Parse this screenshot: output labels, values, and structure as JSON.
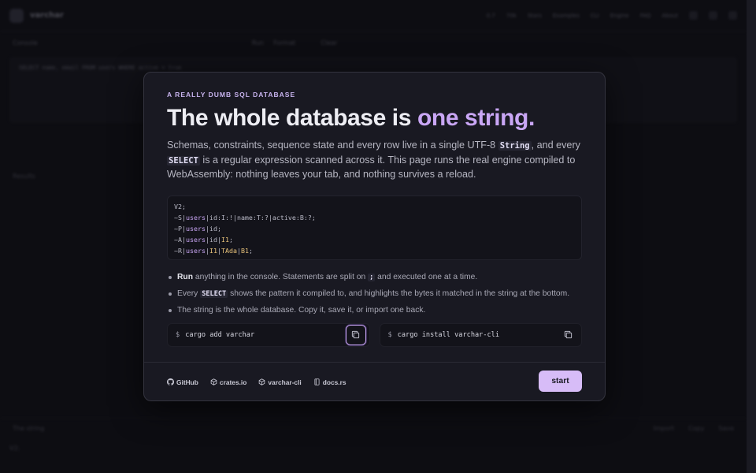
{
  "background": {
    "brand": "varchar",
    "nav": [
      "0.7",
      "70k",
      "Stars",
      "Examples",
      "CLI",
      "Engine",
      "FAQ",
      "About"
    ],
    "console_label": "Console",
    "console_tabs": [
      "Run",
      "Format",
      "Clear"
    ],
    "console_line": "SELECT name, email FROM users WHERE active = true",
    "results_label": "Results",
    "footer_label": "The string",
    "footer_actions": [
      "Import",
      "Copy",
      "Save"
    ],
    "bottom_text": "V2;"
  },
  "modal": {
    "eyebrow": "A REALLY DUMB SQL DATABASE",
    "headline_pre": "The whole database is ",
    "headline_accent": "one string.",
    "lede": {
      "p1": "Schemas, constraints, sequence state and every row live in a single UTF-8 ",
      "code1": "String",
      "p2": ", and every ",
      "code2": "SELECT",
      "p3": " is a regular expression scanned across it. This page runs the real engine compiled to WebAssembly: nothing leaves your tab, and nothing survives a reload."
    },
    "code_lines": [
      "V2;",
      "~S|users|id:I:!|name:T:?|active:B:?;",
      "~P|users|id;",
      "~A|users|id|I1;",
      "~R|users|I1|TAda|B1;"
    ],
    "bullets": {
      "b1_strong": "Run",
      "b1_rest_a": " anything in the console. Statements are split on ",
      "b1_code": ";",
      "b1_rest_b": " and executed one at a time.",
      "b2_a": "Every ",
      "b2_code": "SELECT",
      "b2_b": " shows the pattern it compiled to, and highlights the bytes it matched in the string at the bottom.",
      "b3": "The string is the whole database. Copy it, save it, or import one back."
    },
    "install": [
      {
        "prompt": "$",
        "command": "cargo add varchar"
      },
      {
        "prompt": "$",
        "command": "cargo install varchar-cli"
      }
    ],
    "links": [
      {
        "label": "GitHub",
        "icon": "github-icon"
      },
      {
        "label": "crates.io",
        "icon": "package-icon"
      },
      {
        "label": "varchar-cli",
        "icon": "package-icon"
      },
      {
        "label": "docs.rs",
        "icon": "book-icon"
      }
    ],
    "start_label": "start"
  },
  "colors": {
    "accent": "#c9a6f5",
    "button": "#d7bcf7",
    "modal_bg": "#191922",
    "page_bg": "#0d0d12"
  }
}
